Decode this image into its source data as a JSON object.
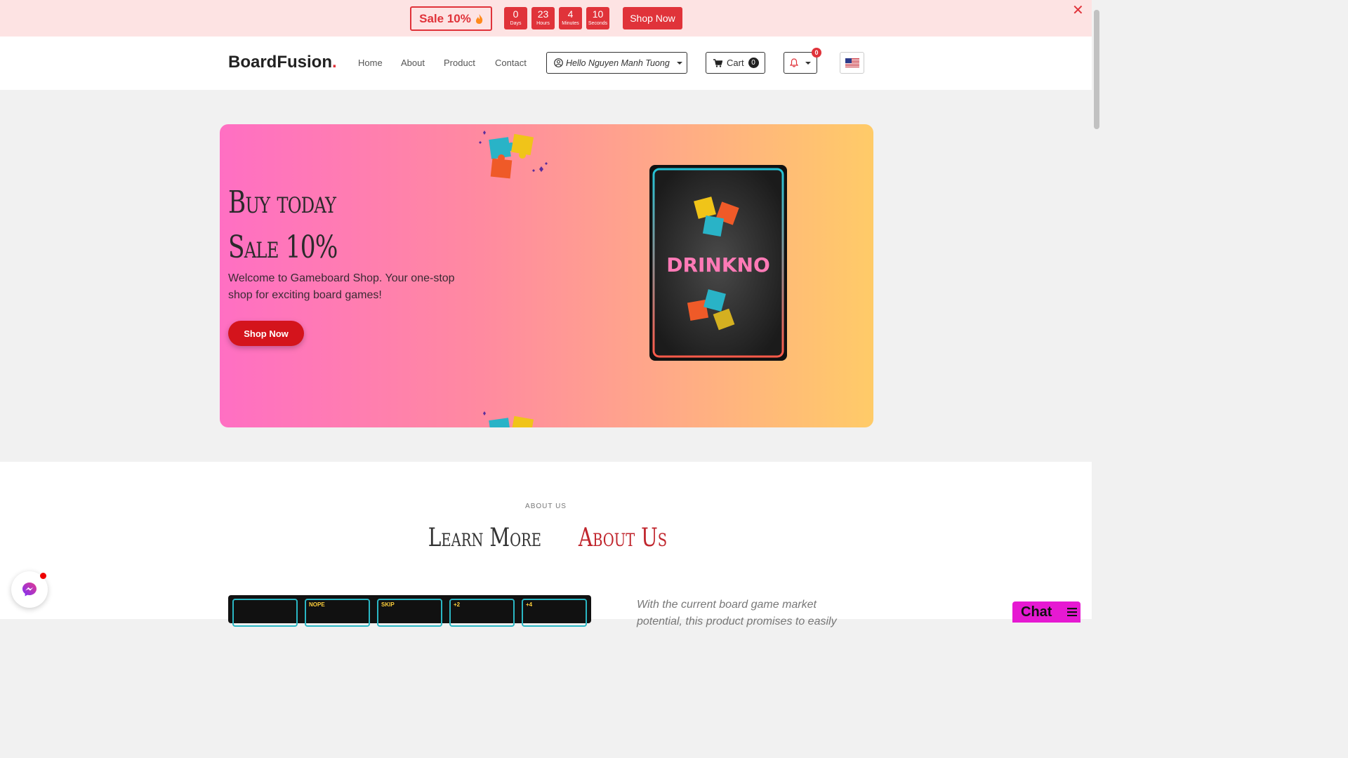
{
  "promo": {
    "sale_label": "Sale 10%",
    "countdown": [
      {
        "value": "0",
        "unit": "Days"
      },
      {
        "value": "23",
        "unit": "Hours"
      },
      {
        "value": "4",
        "unit": "Minutes"
      },
      {
        "value": "10",
        "unit": "Seconds"
      }
    ],
    "shop_label": "Shop Now",
    "close_symbol": "✕"
  },
  "nav": {
    "brand": "BoardFusion",
    "brand_dot": ".",
    "links": [
      "Home",
      "About",
      "Product",
      "Contact"
    ],
    "user_greeting": "Hello Nguyen Manh Tuong",
    "cart_label": "Cart",
    "cart_count": "0",
    "notification_count": "0"
  },
  "hero": {
    "title_line1": "Buy today",
    "title_line2": "Sale 10%",
    "description": "Welcome to Gameboard Shop. Your one-stop shop for exciting board games!",
    "button_label": "Shop Now",
    "card_title": "DRINKNO"
  },
  "about": {
    "eyebrow": "ABOUT US",
    "title_part1": "Learn More",
    "title_part2": "About Us",
    "card_labels": [
      "",
      "NOPE",
      "SKIP",
      "+2",
      "+4"
    ],
    "text": "With the current board game market potential, this product promises to easily"
  },
  "chat": {
    "label": "Chat"
  },
  "colors": {
    "accent": "#e0333a",
    "hero_gradient_start": "#ff6fc3",
    "hero_gradient_end": "#ffcb68",
    "chat_bg": "#e619d2"
  }
}
